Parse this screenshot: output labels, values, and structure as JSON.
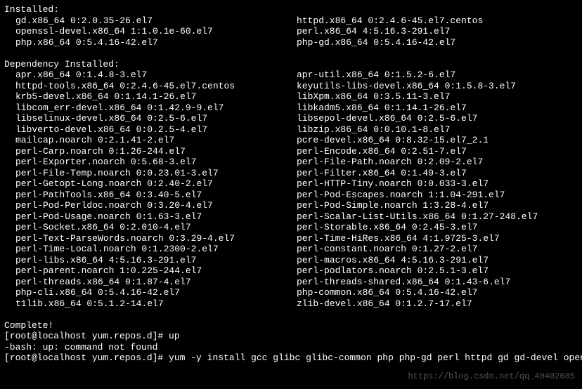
{
  "sections": {
    "installed_label": "Installed:",
    "installed": [
      [
        "gd.x86_64 0:2.0.35-26.el7",
        "httpd.x86_64 0:2.4.6-45.el7.centos"
      ],
      [
        "openssl-devel.x86_64 1:1.0.1e-60.el7",
        "perl.x86_64 4:5.16.3-291.el7"
      ],
      [
        "php.x86_64 0:5.4.16-42.el7",
        "php-gd.x86_64 0:5.4.16-42.el7"
      ]
    ],
    "dep_label": "Dependency Installed:",
    "deps": [
      [
        "apr.x86_64 0:1.4.8-3.el7",
        "apr-util.x86_64 0:1.5.2-6.el7"
      ],
      [
        "httpd-tools.x86_64 0:2.4.6-45.el7.centos",
        "keyutils-libs-devel.x86_64 0:1.5.8-3.el7"
      ],
      [
        "krb5-devel.x86_64 0:1.14.1-26.el7",
        "libXpm.x86_64 0:3.5.11-3.el7"
      ],
      [
        "libcom_err-devel.x86_64 0:1.42.9-9.el7",
        "libkadm5.x86_64 0:1.14.1-26.el7"
      ],
      [
        "libselinux-devel.x86_64 0:2.5-6.el7",
        "libsepol-devel.x86_64 0:2.5-6.el7"
      ],
      [
        "libverto-devel.x86_64 0:0.2.5-4.el7",
        "libzip.x86_64 0:0.10.1-8.el7"
      ],
      [
        "mailcap.noarch 0:2.1.41-2.el7",
        "pcre-devel.x86_64 0:8.32-15.el7_2.1"
      ],
      [
        "perl-Carp.noarch 0:1.26-244.el7",
        "perl-Encode.x86_64 0:2.51-7.el7"
      ],
      [
        "perl-Exporter.noarch 0:5.68-3.el7",
        "perl-File-Path.noarch 0:2.09-2.el7"
      ],
      [
        "perl-File-Temp.noarch 0:0.23.01-3.el7",
        "perl-Filter.x86_64 0:1.49-3.el7"
      ],
      [
        "perl-Getopt-Long.noarch 0:2.40-2.el7",
        "perl-HTTP-Tiny.noarch 0:0.033-3.el7"
      ],
      [
        "perl-PathTools.x86_64 0:3.40-5.el7",
        "perl-Pod-Escapes.noarch 1:1.04-291.el7"
      ],
      [
        "perl-Pod-Perldoc.noarch 0:3.20-4.el7",
        "perl-Pod-Simple.noarch 1:3.28-4.el7"
      ],
      [
        "perl-Pod-Usage.noarch 0:1.63-3.el7",
        "perl-Scalar-List-Utils.x86_64 0:1.27-248.el7"
      ],
      [
        "perl-Socket.x86_64 0:2.010-4.el7",
        "perl-Storable.x86_64 0:2.45-3.el7"
      ],
      [
        "perl-Text-ParseWords.noarch 0:3.29-4.el7",
        "perl-Time-HiRes.x86_64 4:1.9725-3.el7"
      ],
      [
        "perl-Time-Local.noarch 0:1.2300-2.el7",
        "perl-constant.noarch 0:1.27-2.el7"
      ],
      [
        "perl-libs.x86_64 4:5.16.3-291.el7",
        "perl-macros.x86_64 4:5.16.3-291.el7"
      ],
      [
        "perl-parent.noarch 1:0.225-244.el7",
        "perl-podlators.noarch 0:2.5.1-3.el7"
      ],
      [
        "perl-threads.x86_64 0:1.87-4.el7",
        "perl-threads-shared.x86_64 0:1.43-6.el7"
      ],
      [
        "php-cli.x86_64 0:5.4.16-42.el7",
        "php-common.x86_64 0:5.4.16-42.el7"
      ],
      [
        "t1lib.x86_64 0:5.1.2-14.el7",
        "zlib-devel.x86_64 0:1.2.7-17.el7"
      ]
    ],
    "complete": "Complete!",
    "prompt1": "[root@localhost yum.repos.d]# up",
    "error": "-bash: up: command not found",
    "prompt2": "[root@localhost yum.repos.d]# yum -y install gcc glibc glibc-common php php-gd perl httpd gd gd-devel openssl-devel",
    "watermark": "https://blog.csdn.net/qq_40402685"
  }
}
